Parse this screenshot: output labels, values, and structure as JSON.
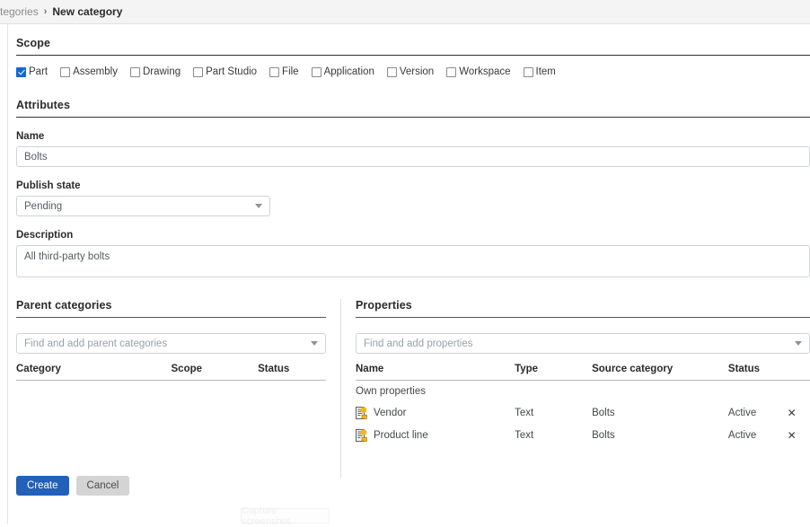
{
  "breadcrumb": {
    "parent": "tegories",
    "separator": "›",
    "current": "New category"
  },
  "scope": {
    "title": "Scope",
    "options": [
      {
        "label": "Part",
        "checked": true
      },
      {
        "label": "Assembly",
        "checked": false
      },
      {
        "label": "Drawing",
        "checked": false
      },
      {
        "label": "Part Studio",
        "checked": false
      },
      {
        "label": "File",
        "checked": false
      },
      {
        "label": "Application",
        "checked": false
      },
      {
        "label": "Version",
        "checked": false
      },
      {
        "label": "Workspace",
        "checked": false
      },
      {
        "label": "Item",
        "checked": false
      }
    ]
  },
  "attributes": {
    "title": "Attributes",
    "name_label": "Name",
    "name_value": "Bolts",
    "publish_state_label": "Publish state",
    "publish_state_value": "Pending",
    "description_label": "Description",
    "description_value": "All third-party bolts"
  },
  "parent_categories": {
    "title": "Parent categories",
    "finder_placeholder": "Find and add parent categories",
    "columns": [
      "Category",
      "Scope",
      "Status"
    ],
    "rows": []
  },
  "properties": {
    "title": "Properties",
    "finder_placeholder": "Find and add properties",
    "columns": [
      "Name",
      "Type",
      "Source category",
      "Status"
    ],
    "group_label": "Own properties",
    "rows": [
      {
        "icon": "property-text-icon",
        "name": "Vendor",
        "type": "Text",
        "source": "Bolts",
        "status": "Active",
        "remove": "✕"
      },
      {
        "icon": "property-text-icon",
        "name": "Product line",
        "type": "Text",
        "source": "Bolts",
        "status": "Active",
        "remove": "✕"
      }
    ]
  },
  "actions": {
    "create_label": "Create",
    "cancel_label": "Cancel"
  },
  "overlay": {
    "capture_tooltip": "Capture screenshot."
  },
  "colors": {
    "primary_button": "#2260ba",
    "checkbox_checked": "#1168d4",
    "icon_accent": "#f3b71b",
    "breadcrumb_bg": "#f4f4f4"
  }
}
